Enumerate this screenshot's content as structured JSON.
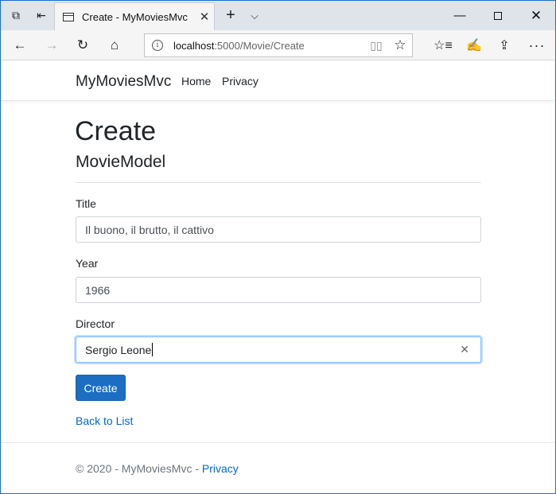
{
  "browser": {
    "tab_title": "Create - MyMoviesMvc",
    "tab_close": "✕",
    "new_tab": "+",
    "tab_list": "⌵",
    "minimize": "—",
    "close": "✕",
    "url_host": "localhost",
    "url_rest": ":5000/Movie/Create",
    "back": "←",
    "forward": "→",
    "refresh": "↻",
    "home": "⌂",
    "info": "i",
    "reading": "▯▯",
    "favorite": "☆",
    "favorites_list": "☆≡",
    "pen": "✍",
    "share": "⇪",
    "more": "···",
    "set_aside": "⧉",
    "tab_back": "⇤"
  },
  "site": {
    "brand": "MyMoviesMvc",
    "nav": {
      "home": "Home",
      "privacy": "Privacy"
    }
  },
  "page": {
    "heading": "Create",
    "subheading": "MovieModel"
  },
  "form": {
    "title": {
      "label": "Title",
      "value": "Il buono, il brutto, il cattivo"
    },
    "year": {
      "label": "Year",
      "value": "1966"
    },
    "director": {
      "label": "Director",
      "value": "Sergio Leone",
      "clear": "✕"
    },
    "submit_label": "Create",
    "back_link": "Back to List"
  },
  "footer": {
    "copyright": "© 2020 - MyMoviesMvc - ",
    "privacy": "Privacy"
  },
  "colors": {
    "accent": "#1b6ec2",
    "link": "#0366d6",
    "focus_border": "#80bdff"
  }
}
